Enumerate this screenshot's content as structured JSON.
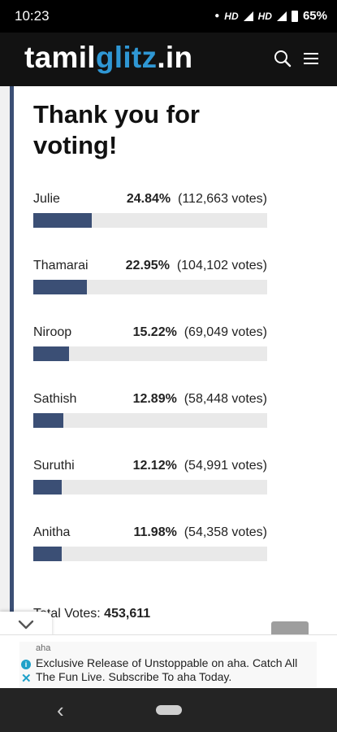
{
  "status_bar": {
    "time": "10:23",
    "network_label": "HD",
    "network_label_2": "HD",
    "roaming": "R",
    "battery": "65%"
  },
  "header": {
    "logo_prefix": "tamil",
    "logo_accent": "glitz",
    "logo_suffix": ".in",
    "accent_color": "#2f97d4"
  },
  "poll": {
    "title": "Thank you for voting!",
    "results": [
      {
        "name": "Julie",
        "percent": "24.84%",
        "votes": "(112,663 votes)",
        "fraction": 0.2484
      },
      {
        "name": "Thamarai",
        "percent": "22.95%",
        "votes": "(104,102 votes)",
        "fraction": 0.2295
      },
      {
        "name": "Niroop",
        "percent": "15.22%",
        "votes": "(69,049 votes)",
        "fraction": 0.1522
      },
      {
        "name": "Sathish",
        "percent": "12.89%",
        "votes": "(58,448 votes)",
        "fraction": 0.1289
      },
      {
        "name": "Suruthi",
        "percent": "12.12%",
        "votes": "(54,991 votes)",
        "fraction": 0.1212
      },
      {
        "name": "Anitha",
        "percent": "11.98%",
        "votes": "(54,358 votes)",
        "fraction": 0.1198
      }
    ],
    "total_label": "Total Votes:",
    "total_value": "453,611",
    "bar_color": "#3b4f75"
  },
  "ad": {
    "brand": "aha",
    "text": "Exclusive Release of Unstoppable on aha. Catch All The Fun Live. Subscribe To aha Today."
  }
}
